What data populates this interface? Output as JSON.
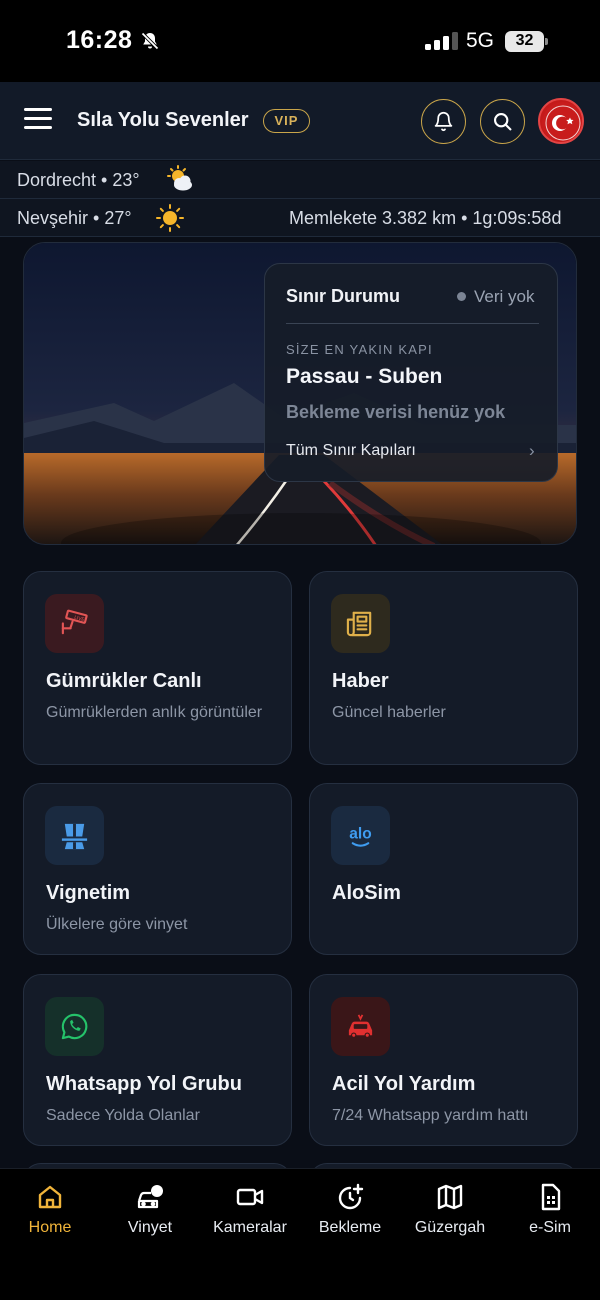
{
  "status_bar": {
    "time": "16:28",
    "network": "5G",
    "battery": "32"
  },
  "header": {
    "title": "Sıla Yolu Sevenler",
    "badge": "VIP"
  },
  "weather": {
    "current": "Dordrecht • 23°",
    "home": "Nevşehir • 27°",
    "distance": "Memlekete 3.382 km • 1g:09s:58d"
  },
  "border_status": {
    "title": "Sınır Durumu",
    "status": "Veri yok",
    "caption": "SİZE EN YAKIN KAPI",
    "gate": "Passau - Suben",
    "wait": "Bekleme verisi henüz yok",
    "link": "Tüm Sınır Kapıları",
    "chevron": "›"
  },
  "tiles": [
    {
      "title": "Gümrükler Canlı",
      "sub": "Gümrüklerden anlık görüntüler",
      "icon": "cctv-camera-icon",
      "color": "#e25555"
    },
    {
      "title": "Haber",
      "sub": "Güncel haberler",
      "icon": "newspaper-icon",
      "color": "#e0b04a"
    },
    {
      "title": "Vignetim",
      "sub": "Ülkelere göre vinyet",
      "icon": "highway-icon",
      "color": "#4a9be8"
    },
    {
      "title": "AloSim",
      "sub": "",
      "icon": "alo-logo-icon",
      "color": "#3f9cf0",
      "logo_text": "alo"
    },
    {
      "title": "Whatsapp Yol Grubu",
      "sub": "Sadece Yolda Olanlar",
      "icon": "whatsapp-icon",
      "color": "#25c26a"
    },
    {
      "title": "Acil Yol Yardım",
      "sub": "7/24 Whatsapp yardım hattı",
      "icon": "car-crash-icon",
      "color": "#e03030"
    }
  ],
  "nav": [
    {
      "label": "Home",
      "icon": "home-icon",
      "active": true
    },
    {
      "label": "Vinyet",
      "icon": "car-alert-icon"
    },
    {
      "label": "Kameralar",
      "icon": "video-camera-icon"
    },
    {
      "label": "Bekleme",
      "icon": "clock-plus-icon"
    },
    {
      "label": "Güzergah",
      "icon": "map-icon"
    },
    {
      "label": "e-Sim",
      "icon": "sim-card-icon"
    }
  ],
  "colors": {
    "accent": "#f0b43a",
    "gold_border": "#c9a54a",
    "background": "#0a0e17"
  }
}
